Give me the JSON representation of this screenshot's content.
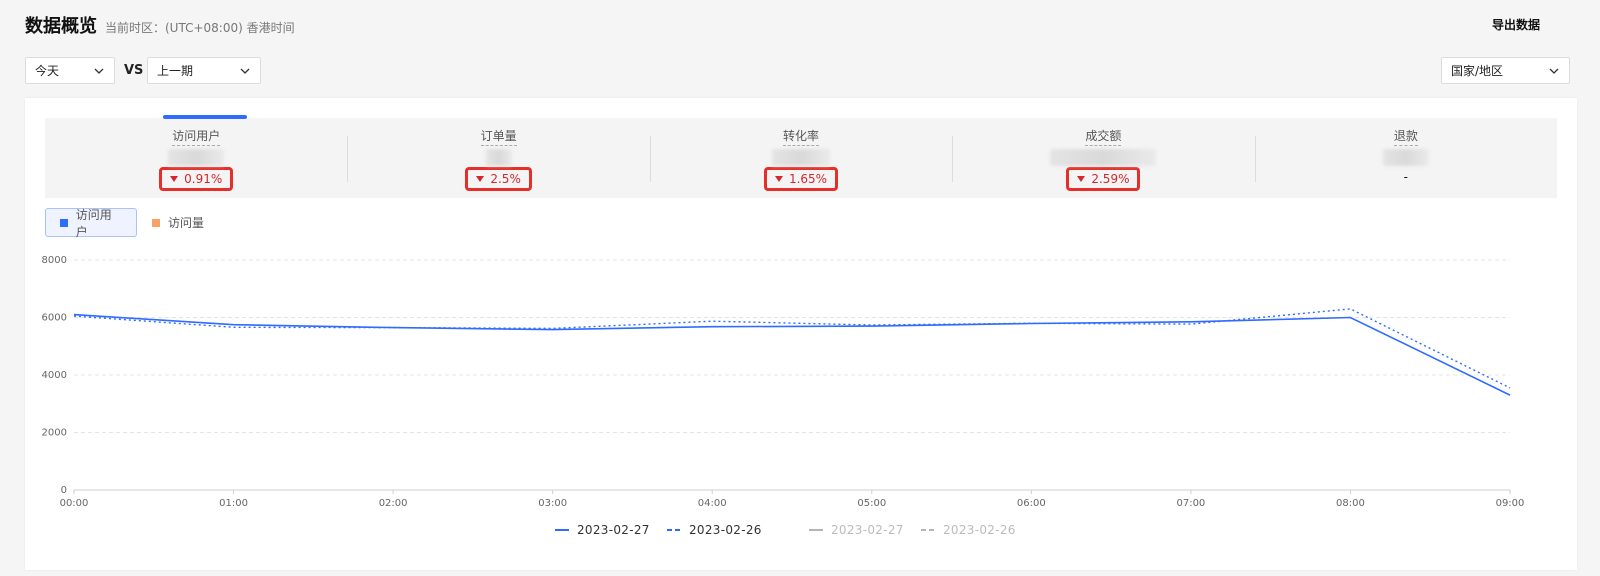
{
  "header": {
    "title": "数据概览",
    "timezone": "当前时区：(UTC+08:00) 香港时间",
    "export_label": "导出数据"
  },
  "filters": {
    "period": "今天",
    "vs": "VS",
    "compare": "上一期",
    "region": "国家/地区"
  },
  "metrics": [
    {
      "label": "访问用户",
      "delta": "0.91%",
      "direction": "down",
      "active": true
    },
    {
      "label": "订单量",
      "delta": "2.5%",
      "direction": "down",
      "active": false
    },
    {
      "label": "转化率",
      "delta": "1.65%",
      "direction": "down",
      "active": false
    },
    {
      "label": "成交额",
      "delta": "2.59%",
      "direction": "down",
      "active": false
    },
    {
      "label": "退款",
      "delta": "-",
      "direction": "none",
      "active": false
    }
  ],
  "toggles": [
    {
      "label": "访问用户",
      "color": "#2f6bff",
      "active": true
    },
    {
      "label": "访问量",
      "color": "#f7a267",
      "active": false
    }
  ],
  "colors": {
    "accent": "#2f6bff",
    "highlight": "#e4302b",
    "muted": "#b5b5b5"
  },
  "chart_data": {
    "type": "line",
    "x": [
      "00:00",
      "01:00",
      "02:00",
      "03:00",
      "04:00",
      "05:00",
      "06:00",
      "07:00",
      "08:00",
      "09:00"
    ],
    "ylim": [
      0,
      8000
    ],
    "yticks": [
      0,
      2000,
      4000,
      6000,
      8000
    ],
    "grid": true,
    "legend_position": "bottom-center",
    "series": [
      {
        "name": "2023-02-27",
        "style": "solid",
        "color": "#2f6bff",
        "values": [
          6100,
          5750,
          5650,
          5580,
          5680,
          5700,
          5790,
          5850,
          6000,
          3300
        ]
      },
      {
        "name": "2023-02-26",
        "style": "dotted",
        "color": "#2f6bff",
        "values": [
          6050,
          5660,
          5650,
          5620,
          5870,
          5740,
          5800,
          5770,
          6300,
          3550
        ]
      }
    ],
    "legend": [
      {
        "name": "2023-02-27",
        "style": "solid",
        "color": "#2f6bff",
        "muted": false
      },
      {
        "name": "2023-02-26",
        "style": "dashed",
        "color": "#2f6bff",
        "muted": false
      },
      {
        "name": "2023-02-27",
        "style": "solid",
        "color": "#b5b5b5",
        "muted": true
      },
      {
        "name": "2023-02-26",
        "style": "dashed",
        "color": "#b5b5b5",
        "muted": true
      }
    ]
  }
}
